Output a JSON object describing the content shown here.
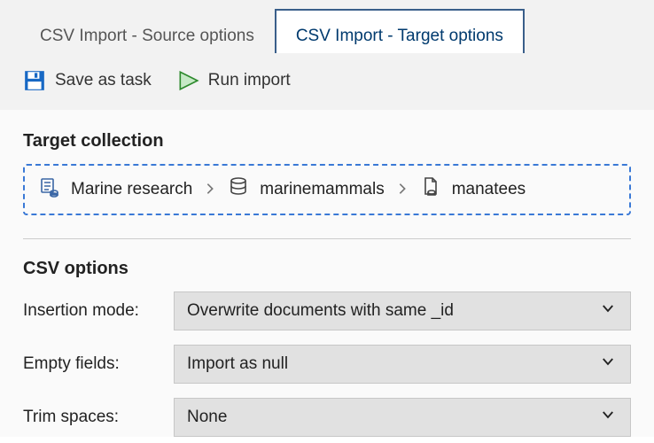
{
  "tabs": {
    "source": "CSV Import - Source options",
    "target": "CSV Import - Target options",
    "active": "target"
  },
  "toolbar": {
    "save_label": "Save as task",
    "run_label": "Run import"
  },
  "target_section": {
    "title": "Target collection",
    "breadcrumb": {
      "project": "Marine research",
      "database": "marinemammals",
      "collection": "manatees"
    }
  },
  "csv_options": {
    "title": "CSV options",
    "insertion_mode": {
      "label": "Insertion mode:",
      "value": "Overwrite documents with same _id"
    },
    "empty_fields": {
      "label": "Empty fields:",
      "value": "Import as null"
    },
    "trim_spaces": {
      "label": "Trim spaces:",
      "value": "None"
    }
  },
  "colors": {
    "accent": "#3a79d6",
    "tab_active_border": "#3a5f8a",
    "tab_active_text": "#003a6e"
  }
}
